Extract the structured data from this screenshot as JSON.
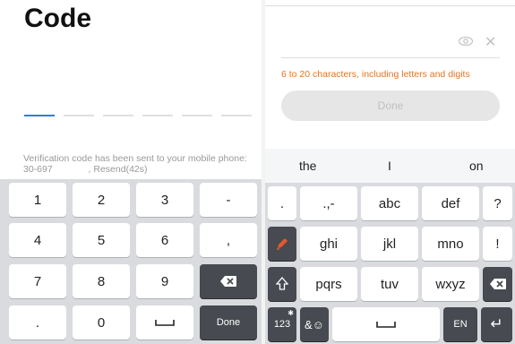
{
  "left": {
    "title": "Code",
    "verify_line1": "Verification code has been sent to your mobile phone:",
    "verify_phone": "30-697",
    "verify_resend": ", Resend(42s)",
    "keys": [
      {
        "label": "1",
        "style": "light"
      },
      {
        "label": "2",
        "style": "light"
      },
      {
        "label": "3",
        "style": "light"
      },
      {
        "label": "-",
        "style": "light"
      },
      {
        "label": "4",
        "style": "light"
      },
      {
        "label": "5",
        "style": "light"
      },
      {
        "label": "6",
        "style": "light"
      },
      {
        "label": ",",
        "style": "light"
      },
      {
        "label": "7",
        "style": "light"
      },
      {
        "label": "8",
        "style": "light"
      },
      {
        "label": "9",
        "style": "light"
      },
      {
        "label": "",
        "style": "dark",
        "icon": "backspace-icon"
      },
      {
        "label": ".",
        "style": "light"
      },
      {
        "label": "0",
        "style": "light"
      },
      {
        "label": "",
        "style": "light",
        "icon": "space-icon"
      },
      {
        "label": "Done",
        "style": "dark"
      }
    ]
  },
  "right": {
    "password_hint": "6 to 20 characters, including letters and digits",
    "done_label": "Done",
    "suggestions": [
      "the",
      "I",
      "on"
    ],
    "row1": [
      ".",
      ".,-",
      "abc",
      "def",
      "?"
    ],
    "row2": [
      "",
      "ghi",
      "jkl",
      "mno",
      "!"
    ],
    "row3": [
      "",
      "pqrs",
      "tuv",
      "wxyz",
      ""
    ],
    "row4": [
      "123",
      "&☺",
      "",
      "EN",
      "↵"
    ]
  },
  "colors": {
    "accent_blue": "#2e7fd6",
    "hint_orange": "#e8741e",
    "key_dark": "#474a50",
    "keyboard_bg": "#d9dbdf"
  }
}
